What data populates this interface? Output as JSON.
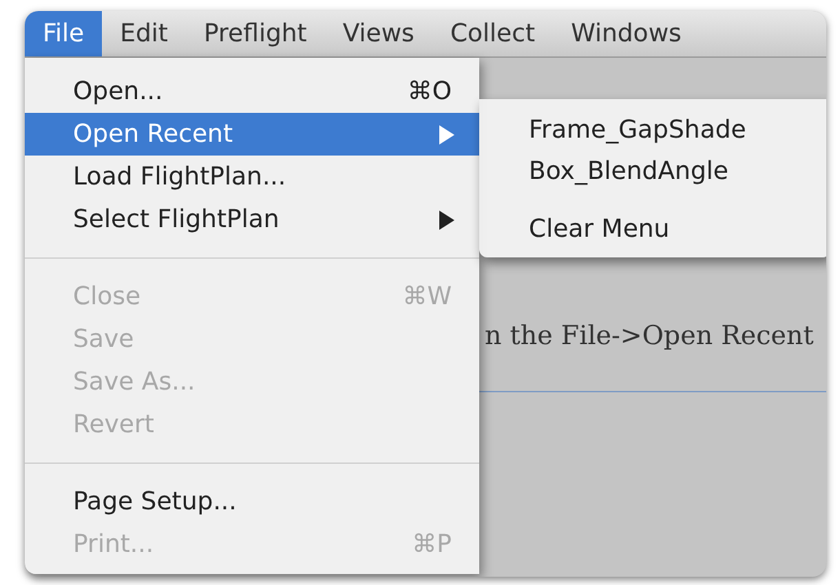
{
  "menubar": [
    {
      "label": "File",
      "selected": true
    },
    {
      "label": "Edit",
      "selected": false
    },
    {
      "label": "Preflight",
      "selected": false
    },
    {
      "label": "Views",
      "selected": false
    },
    {
      "label": "Collect",
      "selected": false
    },
    {
      "label": "Windows",
      "selected": false
    }
  ],
  "background_text": "n the File->Open Recent",
  "file_menu": [
    {
      "kind": "item",
      "label": "Open...",
      "shortcut": "⌘O",
      "disabled": false,
      "selected": false,
      "submenu": false
    },
    {
      "kind": "item",
      "label": "Open Recent",
      "disabled": false,
      "selected": true,
      "submenu": true
    },
    {
      "kind": "item",
      "label": "Load FlightPlan...",
      "disabled": false,
      "selected": false,
      "submenu": false
    },
    {
      "kind": "item",
      "label": "Select FlightPlan",
      "disabled": false,
      "selected": false,
      "submenu": true
    },
    {
      "kind": "separator"
    },
    {
      "kind": "item",
      "label": "Close",
      "shortcut": "⌘W",
      "disabled": true,
      "selected": false,
      "submenu": false
    },
    {
      "kind": "item",
      "label": "Save",
      "disabled": true,
      "selected": false,
      "submenu": false
    },
    {
      "kind": "item",
      "label": "Save As...",
      "disabled": true,
      "selected": false,
      "submenu": false
    },
    {
      "kind": "item",
      "label": "Revert",
      "disabled": true,
      "selected": false,
      "submenu": false
    },
    {
      "kind": "separator"
    },
    {
      "kind": "item",
      "label": "Page Setup...",
      "disabled": false,
      "selected": false,
      "submenu": false
    },
    {
      "kind": "item",
      "label": "Print...",
      "shortcut": "⌘P",
      "disabled": true,
      "selected": false,
      "submenu": false
    }
  ],
  "recent_submenu": [
    {
      "kind": "item",
      "label": "Frame_GapShade"
    },
    {
      "kind": "item",
      "label": "Box_BlendAngle"
    },
    {
      "kind": "separator"
    },
    {
      "kind": "item",
      "label": "Clear Menu"
    }
  ]
}
